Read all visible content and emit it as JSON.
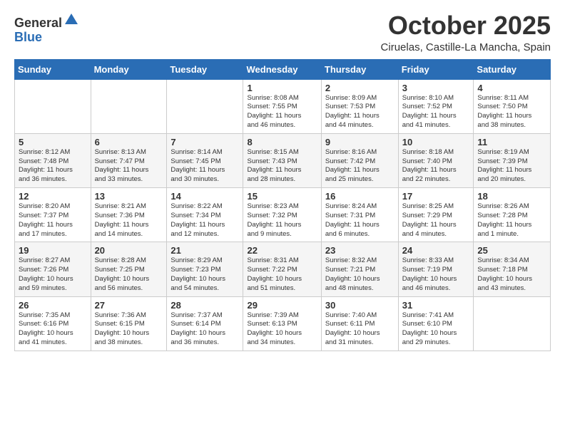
{
  "logo": {
    "general": "General",
    "blue": "Blue"
  },
  "header": {
    "month": "October 2025",
    "location": "Ciruelas, Castille-La Mancha, Spain"
  },
  "weekdays": [
    "Sunday",
    "Monday",
    "Tuesday",
    "Wednesday",
    "Thursday",
    "Friday",
    "Saturday"
  ],
  "weeks": [
    [
      {
        "day": "",
        "info": ""
      },
      {
        "day": "",
        "info": ""
      },
      {
        "day": "",
        "info": ""
      },
      {
        "day": "1",
        "info": "Sunrise: 8:08 AM\nSunset: 7:55 PM\nDaylight: 11 hours\nand 46 minutes."
      },
      {
        "day": "2",
        "info": "Sunrise: 8:09 AM\nSunset: 7:53 PM\nDaylight: 11 hours\nand 44 minutes."
      },
      {
        "day": "3",
        "info": "Sunrise: 8:10 AM\nSunset: 7:52 PM\nDaylight: 11 hours\nand 41 minutes."
      },
      {
        "day": "4",
        "info": "Sunrise: 8:11 AM\nSunset: 7:50 PM\nDaylight: 11 hours\nand 38 minutes."
      }
    ],
    [
      {
        "day": "5",
        "info": "Sunrise: 8:12 AM\nSunset: 7:48 PM\nDaylight: 11 hours\nand 36 minutes."
      },
      {
        "day": "6",
        "info": "Sunrise: 8:13 AM\nSunset: 7:47 PM\nDaylight: 11 hours\nand 33 minutes."
      },
      {
        "day": "7",
        "info": "Sunrise: 8:14 AM\nSunset: 7:45 PM\nDaylight: 11 hours\nand 30 minutes."
      },
      {
        "day": "8",
        "info": "Sunrise: 8:15 AM\nSunset: 7:43 PM\nDaylight: 11 hours\nand 28 minutes."
      },
      {
        "day": "9",
        "info": "Sunrise: 8:16 AM\nSunset: 7:42 PM\nDaylight: 11 hours\nand 25 minutes."
      },
      {
        "day": "10",
        "info": "Sunrise: 8:18 AM\nSunset: 7:40 PM\nDaylight: 11 hours\nand 22 minutes."
      },
      {
        "day": "11",
        "info": "Sunrise: 8:19 AM\nSunset: 7:39 PM\nDaylight: 11 hours\nand 20 minutes."
      }
    ],
    [
      {
        "day": "12",
        "info": "Sunrise: 8:20 AM\nSunset: 7:37 PM\nDaylight: 11 hours\nand 17 minutes."
      },
      {
        "day": "13",
        "info": "Sunrise: 8:21 AM\nSunset: 7:36 PM\nDaylight: 11 hours\nand 14 minutes."
      },
      {
        "day": "14",
        "info": "Sunrise: 8:22 AM\nSunset: 7:34 PM\nDaylight: 11 hours\nand 12 minutes."
      },
      {
        "day": "15",
        "info": "Sunrise: 8:23 AM\nSunset: 7:32 PM\nDaylight: 11 hours\nand 9 minutes."
      },
      {
        "day": "16",
        "info": "Sunrise: 8:24 AM\nSunset: 7:31 PM\nDaylight: 11 hours\nand 6 minutes."
      },
      {
        "day": "17",
        "info": "Sunrise: 8:25 AM\nSunset: 7:29 PM\nDaylight: 11 hours\nand 4 minutes."
      },
      {
        "day": "18",
        "info": "Sunrise: 8:26 AM\nSunset: 7:28 PM\nDaylight: 11 hours\nand 1 minute."
      }
    ],
    [
      {
        "day": "19",
        "info": "Sunrise: 8:27 AM\nSunset: 7:26 PM\nDaylight: 10 hours\nand 59 minutes."
      },
      {
        "day": "20",
        "info": "Sunrise: 8:28 AM\nSunset: 7:25 PM\nDaylight: 10 hours\nand 56 minutes."
      },
      {
        "day": "21",
        "info": "Sunrise: 8:29 AM\nSunset: 7:23 PM\nDaylight: 10 hours\nand 54 minutes."
      },
      {
        "day": "22",
        "info": "Sunrise: 8:31 AM\nSunset: 7:22 PM\nDaylight: 10 hours\nand 51 minutes."
      },
      {
        "day": "23",
        "info": "Sunrise: 8:32 AM\nSunset: 7:21 PM\nDaylight: 10 hours\nand 48 minutes."
      },
      {
        "day": "24",
        "info": "Sunrise: 8:33 AM\nSunset: 7:19 PM\nDaylight: 10 hours\nand 46 minutes."
      },
      {
        "day": "25",
        "info": "Sunrise: 8:34 AM\nSunset: 7:18 PM\nDaylight: 10 hours\nand 43 minutes."
      }
    ],
    [
      {
        "day": "26",
        "info": "Sunrise: 7:35 AM\nSunset: 6:16 PM\nDaylight: 10 hours\nand 41 minutes."
      },
      {
        "day": "27",
        "info": "Sunrise: 7:36 AM\nSunset: 6:15 PM\nDaylight: 10 hours\nand 38 minutes."
      },
      {
        "day": "28",
        "info": "Sunrise: 7:37 AM\nSunset: 6:14 PM\nDaylight: 10 hours\nand 36 minutes."
      },
      {
        "day": "29",
        "info": "Sunrise: 7:39 AM\nSunset: 6:13 PM\nDaylight: 10 hours\nand 34 minutes."
      },
      {
        "day": "30",
        "info": "Sunrise: 7:40 AM\nSunset: 6:11 PM\nDaylight: 10 hours\nand 31 minutes."
      },
      {
        "day": "31",
        "info": "Sunrise: 7:41 AM\nSunset: 6:10 PM\nDaylight: 10 hours\nand 29 minutes."
      },
      {
        "day": "",
        "info": ""
      }
    ]
  ]
}
